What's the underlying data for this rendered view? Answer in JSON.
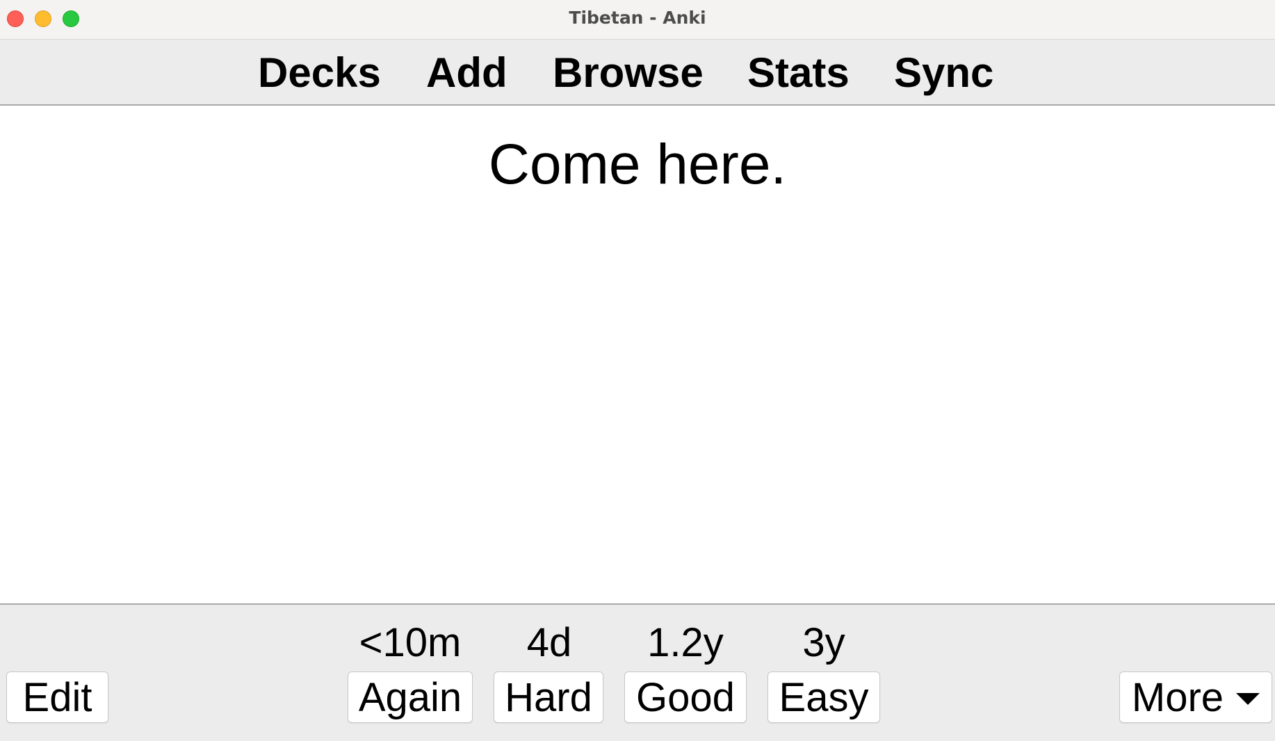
{
  "window": {
    "title": "Tibetan - Anki"
  },
  "toolbar": {
    "decks": "Decks",
    "add": "Add",
    "browse": "Browse",
    "stats": "Stats",
    "sync": "Sync"
  },
  "card": {
    "front_text": "Come here."
  },
  "answer_bar": {
    "edit_label": "Edit",
    "more_label": "More",
    "more_icon": "chevron-down-icon",
    "buttons": [
      {
        "label": "Again",
        "interval": "<10m"
      },
      {
        "label": "Hard",
        "interval": "4d"
      },
      {
        "label": "Good",
        "interval": "1.2y"
      },
      {
        "label": "Easy",
        "interval": "3y"
      }
    ]
  },
  "colors": {
    "close": "#fe5f57",
    "minimize": "#febc2e",
    "maximize": "#28c840",
    "toolbar_bg": "#ececec"
  }
}
